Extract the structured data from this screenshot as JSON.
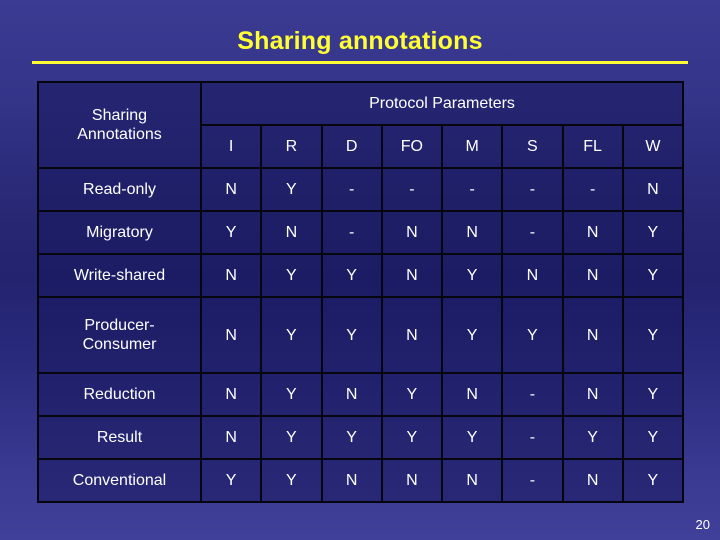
{
  "slide": {
    "title": "Sharing annotations",
    "page_number": "20",
    "accent_color": "#ffff33",
    "text_color": "#ffffff",
    "background_color": "#2a2a7a"
  },
  "table": {
    "corner_label_line1": "Sharing",
    "corner_label_line2": "Annotations",
    "group_header": "Protocol Parameters",
    "columns": [
      "I",
      "R",
      "D",
      "FO",
      "M",
      "S",
      "FL",
      "W"
    ],
    "rows": [
      {
        "label": "Read-only",
        "label_line1": "Read-only",
        "label_line2": "",
        "values": [
          "N",
          "Y",
          "-",
          "-",
          "-",
          "-",
          "-",
          "N"
        ]
      },
      {
        "label": "Migratory",
        "label_line1": "Migratory",
        "label_line2": "",
        "values": [
          "Y",
          "N",
          "-",
          "N",
          "N",
          "-",
          "N",
          "Y"
        ]
      },
      {
        "label": "Write-shared",
        "label_line1": "Write-shared",
        "label_line2": "",
        "values": [
          "N",
          "Y",
          "Y",
          "N",
          "Y",
          "N",
          "N",
          "Y"
        ]
      },
      {
        "label": "Producer-Consumer",
        "label_line1": "Producer-",
        "label_line2": "Consumer",
        "values": [
          "N",
          "Y",
          "Y",
          "N",
          "Y",
          "Y",
          "N",
          "Y"
        ]
      },
      {
        "label": "Reduction",
        "label_line1": "Reduction",
        "label_line2": "",
        "values": [
          "N",
          "Y",
          "N",
          "Y",
          "N",
          "-",
          "N",
          "Y"
        ]
      },
      {
        "label": "Result",
        "label_line1": "Result",
        "label_line2": "",
        "values": [
          "N",
          "Y",
          "Y",
          "Y",
          "Y",
          "-",
          "Y",
          "Y"
        ]
      },
      {
        "label": "Conventional",
        "label_line1": "Conventional",
        "label_line2": "",
        "values": [
          "Y",
          "Y",
          "N",
          "N",
          "N",
          "-",
          "N",
          "Y"
        ]
      }
    ]
  }
}
